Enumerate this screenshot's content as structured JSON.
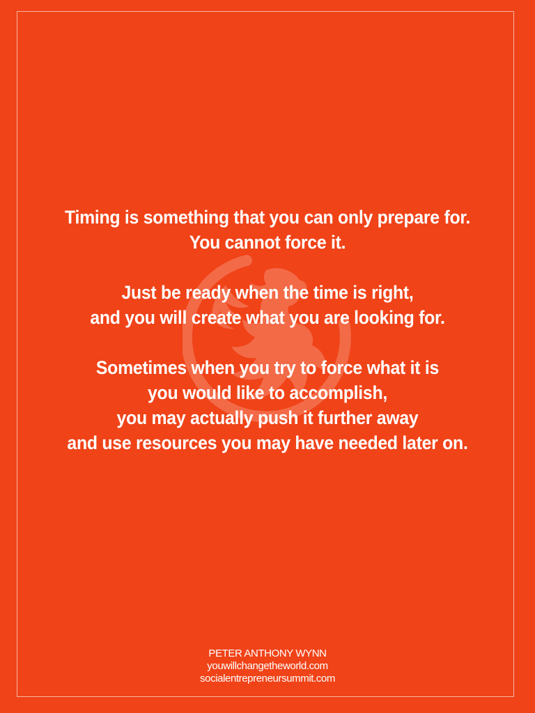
{
  "colors": {
    "background": "#f04318",
    "border": "#f9b7a3",
    "text": "#ffffff",
    "watermark": "#f8a489"
  },
  "watermark": {
    "icon": "griffin-circle-logo-icon"
  },
  "quote": {
    "paragraphs": [
      {
        "lines": [
          "Timing is something that you can only prepare for.",
          "You cannot force it."
        ]
      },
      {
        "lines": [
          "Just be ready when the time is right,",
          "and you will create what you are looking for."
        ]
      },
      {
        "lines": [
          "Sometimes when you try to force what it is",
          "you would like to accomplish,",
          "you may actually push it further away",
          "and use resources you may have needed later on."
        ]
      }
    ]
  },
  "signature": {
    "name": "PETER ANTHONY WYNN",
    "website1": "youwillchangetheworld.com",
    "website2": "socialentrepreneursummit.com"
  }
}
